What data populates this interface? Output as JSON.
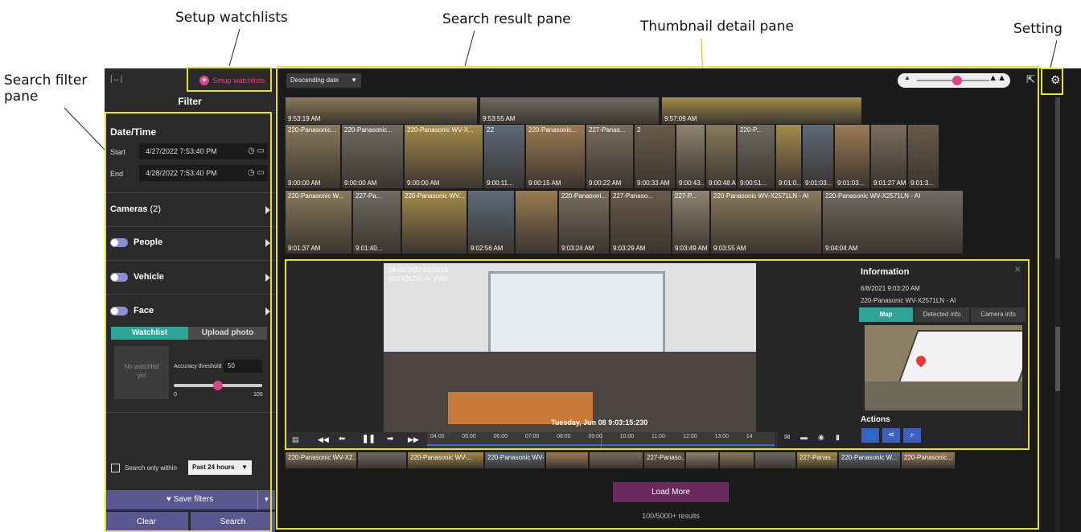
{
  "annotations": {
    "setup_watchlists": "Setup watchlists",
    "search_result_pane": "Search result pane",
    "thumbnail_detail_pane": "Thumbnail detail pane",
    "setting": "Setting",
    "search_filter_pane": "Search filter\npane"
  },
  "filter": {
    "collapse_icon": "|↔|",
    "setup_watchlists": "Setup watchlists",
    "title": "Filter",
    "datetime_title": "Date/Time",
    "start_label": "Start",
    "start_value": "4/27/2022   7:53:40 PM",
    "end_label": "End",
    "end_value": "4/28/2022   7:53:40 PM",
    "cameras_label": "Cameras",
    "cameras_count": "(2)",
    "people": "People",
    "vehicle": "Vehicle",
    "face": "Face",
    "tab_watchlist": "Watchlist",
    "tab_upload": "Upload photo",
    "no_watchlist": "No watchlist\nyet",
    "accuracy_label": "Accuracy threshold",
    "accuracy_value": "50",
    "slider_min": "0",
    "slider_max": "100",
    "slider_value": 50,
    "search_within_label": "Search only within",
    "search_within_value": "Past 24 hours",
    "save_filters": "Save filters",
    "clear": "Clear",
    "search": "Search"
  },
  "results": {
    "sort_label": "Descending date",
    "zoom_value": 0.55,
    "row1": [
      {
        "ts": "9:53:19 AM"
      },
      {
        "ts": "9:53:55 AM"
      },
      {
        "ts": "9:57:09 AM"
      }
    ],
    "row2": [
      {
        "label": "220-Panasonic...",
        "ts": "9:00:00 AM"
      },
      {
        "label": "220-Panasonic...",
        "ts": "9:00:00 AM"
      },
      {
        "label": "220-Panasonic WV-X...",
        "ts": "9:00:00 AM"
      },
      {
        "label": "22",
        "ts": "9:00:11..."
      },
      {
        "label": "220-Panasonic...",
        "ts": "9:00:15 AM"
      },
      {
        "label": "227-Panas...",
        "ts": "9:00:22 AM"
      },
      {
        "label": "2",
        "ts": "9:00:33 AM"
      },
      {
        "label": "",
        "ts": "9:00:43..."
      },
      {
        "label": "",
        "ts": "9:00:48 AM"
      },
      {
        "label": "220-P...",
        "ts": "9:00:51..."
      },
      {
        "label": "",
        "ts": "9:01:0..."
      },
      {
        "label": "",
        "ts": "9:01:03..."
      },
      {
        "label": "",
        "ts": "9:01:03..."
      },
      {
        "label": "",
        "ts": "9:01:27 AM"
      },
      {
        "label": "",
        "ts": "9:01:3..."
      }
    ],
    "row3": [
      {
        "label": "220-Panasonic W...",
        "ts": "9:01:37 AM"
      },
      {
        "label": "227-Pa...",
        "ts": "9:01:40..."
      },
      {
        "label": "220-Panasonic WV...",
        "ts": ""
      },
      {
        "label": "",
        "ts": "9:02:56 AM"
      },
      {
        "label": "",
        "ts": ""
      },
      {
        "label": "220-Panasoni...",
        "ts": "9:03:24 AM"
      },
      {
        "label": "227-Panaso...",
        "ts": "9:03:29 AM"
      },
      {
        "label": "227-P...",
        "ts": "9:03:49 AM"
      },
      {
        "label": "220-Panasonic WV-X2571LN - AI",
        "ts": "9:03:55 AM"
      },
      {
        "label": "220-Panasonic WV-X2571LN - AI",
        "ts": "9:04:04 AM"
      }
    ],
    "detail": {
      "osd_line1": "06-08-2022 09:03:15",
      "osd_line2": "WV-X2571L-AI VMD",
      "video_timestamp": "Tuesday, Jun 08  9:03:15:230",
      "timeline_labels": [
        "04:00",
        "05:00",
        "06:00",
        "07:00",
        "08:00",
        "09:00",
        "10:00",
        "11:00",
        "12:00",
        "13:00",
        "14"
      ],
      "info_title": "Information",
      "info_date": "6/8/2021 9:03:20 AM",
      "info_camera": "220-Panasonic WV-X2571LN - AI",
      "tab_map": "Map",
      "tab_detected": "Detected info",
      "tab_camera": "Camera info",
      "actions_title": "Actions",
      "close": "×"
    },
    "bottom_row": [
      {
        "label": "220-Panasonic WV-X2..."
      },
      {
        "label": ""
      },
      {
        "label": "220-Panasonic WV-..."
      },
      {
        "label": "220-Panasonic WV-X2..."
      },
      {
        "label": ""
      },
      {
        "label": ""
      },
      {
        "label": "227-Panaso..."
      },
      {
        "label": ""
      },
      {
        "label": ""
      },
      {
        "label": ""
      },
      {
        "label": "227-Panas..."
      },
      {
        "label": "220-Panasonic W..."
      },
      {
        "label": "220-Panasonic..."
      }
    ],
    "load_more": "Load More",
    "result_count": "100/5000+ results"
  },
  "colors": {
    "accent_pink": "#d9478a",
    "teal": "#2fa394",
    "purple_button": "#6a2a5e",
    "save_bar": "#5a5690",
    "highlight": "#e6e22a"
  }
}
